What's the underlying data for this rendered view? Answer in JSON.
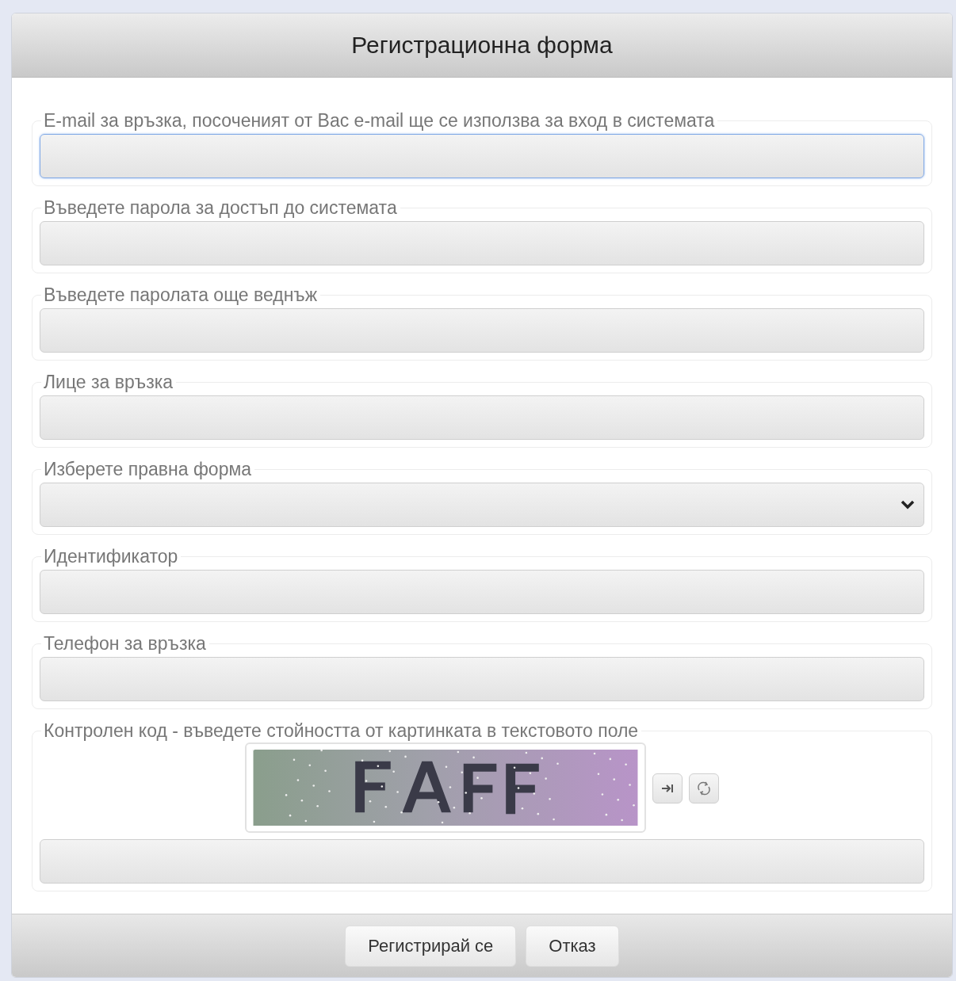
{
  "dialog": {
    "title": "Регистрационна форма"
  },
  "fields": [
    {
      "label": "E-mail за връзка, посоченият от Вас e-mail ще се използва за вход в системата",
      "kind": "input",
      "focused": true
    },
    {
      "label": "Въведете парола за достъп до системата",
      "kind": "input",
      "focused": false
    },
    {
      "label": "Въведете паролата още веднъж",
      "kind": "input",
      "focused": false
    },
    {
      "label": "Лице за връзка",
      "kind": "input",
      "focused": false
    },
    {
      "label": "Изберете правна форма",
      "kind": "select",
      "focused": false
    },
    {
      "label": "Идентификатор",
      "kind": "input",
      "focused": false
    },
    {
      "label": "Телефон за връзка",
      "kind": "input",
      "focused": false
    },
    {
      "label": "Контролен код - въведете стойността от картинката в текстовото поле",
      "kind": "captcha",
      "focused": false
    }
  ],
  "buttons": [
    "Регистрирай се",
    "Отказ"
  ]
}
